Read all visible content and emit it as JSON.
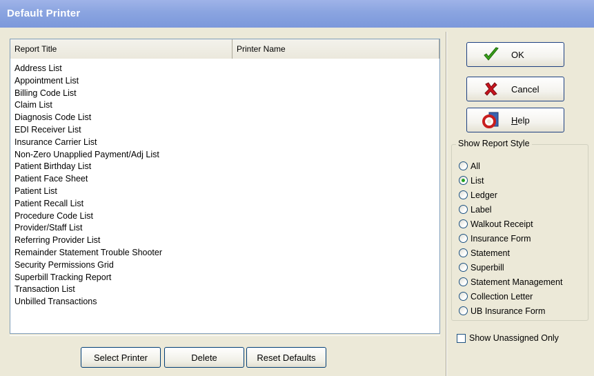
{
  "window": {
    "title": "Default Printer"
  },
  "table": {
    "columns": [
      "Report Title",
      "Printer Name"
    ],
    "rows": [
      "Address List",
      "Appointment List",
      "Billing Code List",
      "Claim List",
      "Diagnosis Code List",
      "EDI Receiver List",
      "Insurance Carrier List",
      "Non-Zero Unapplied Payment/Adj List",
      "Patient Birthday List",
      "Patient Face Sheet",
      "Patient List",
      "Patient Recall List",
      "Procedure Code List",
      "Provider/Staff List",
      "Referring Provider List",
      "Remainder Statement Trouble Shooter",
      "Security Permissions Grid",
      "Superbill Tracking Report",
      "Transaction List",
      "Unbilled Transactions"
    ]
  },
  "buttons": {
    "select_printer": "Select Printer",
    "delete": "Delete",
    "reset_defaults": "Reset Defaults",
    "ok": "OK",
    "cancel": "Cancel",
    "help": "Help"
  },
  "report_style": {
    "legend": "Show Report Style",
    "options": [
      "All",
      "List",
      "Ledger",
      "Label",
      "Walkout Receipt",
      "Insurance Form",
      "Statement",
      "Superbill",
      "Statement Management",
      "Collection Letter",
      "UB Insurance Form"
    ],
    "selected": "List"
  },
  "show_unassigned": {
    "label": "Show Unassigned Only",
    "checked": false
  },
  "icons": {
    "ok": "checkmark-icon",
    "cancel": "x-icon",
    "help": "help-lifebuoy-icon"
  },
  "colors": {
    "title_bar": "#7c98db",
    "window_bg": "#ECE9D8",
    "ok_icon": "#3aa01a",
    "cancel_icon": "#c8141e",
    "radio_selected": "#21a121"
  }
}
